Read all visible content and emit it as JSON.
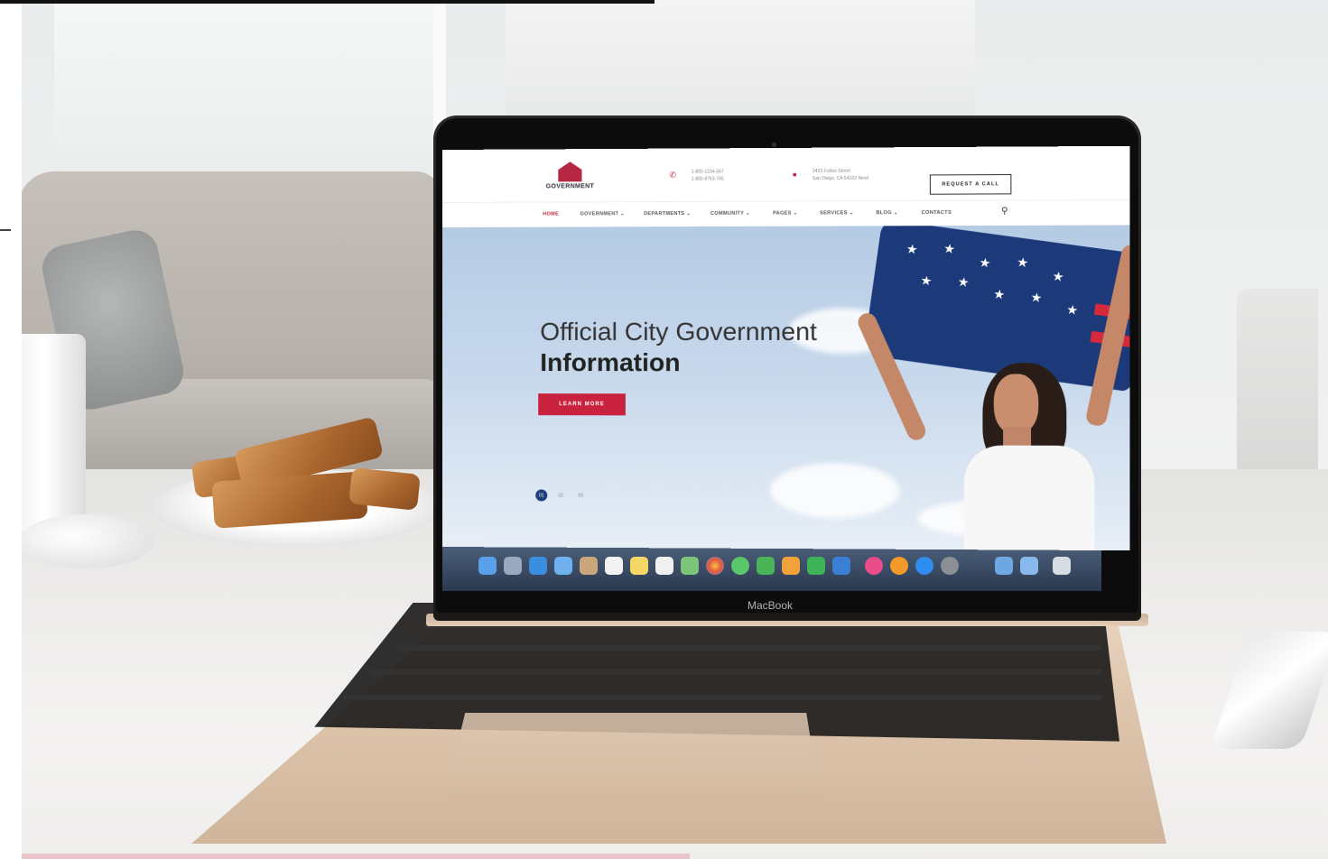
{
  "device": {
    "brand_label": "MacBook"
  },
  "site": {
    "logo_text": "GOVERNMENT",
    "contacts": [
      {
        "icon": "phone-icon",
        "line1": "1-800-1234-567",
        "line2": "1-800-8763-765"
      },
      {
        "icon": "location-pin-icon",
        "line1": "2415 Fulton Street",
        "line2": "San Diego, CA 54103 NewI"
      }
    ],
    "request_button": "REQUEST A CALL",
    "nav": [
      {
        "label": "HOME",
        "active": true
      },
      {
        "label": "GOVERNMENT ⌄",
        "active": false
      },
      {
        "label": "DEPARTMENTS ⌄",
        "active": false
      },
      {
        "label": "COMMUNITY ⌄",
        "active": false
      },
      {
        "label": "PAGES ⌄",
        "active": false
      },
      {
        "label": "SERVICES ⌄",
        "active": false
      },
      {
        "label": "BLOG ⌄",
        "active": false
      },
      {
        "label": "CONTACTS",
        "active": false
      }
    ],
    "search_icon": "search-icon",
    "hero": {
      "title_line1": "Official City Government",
      "title_line2": "Information",
      "button": "LEARN MORE",
      "slides": [
        "01",
        "02",
        "03"
      ],
      "active_slide": 0
    },
    "colors": {
      "brand_red": "#c8223e",
      "navy": "#1e3f79"
    }
  }
}
